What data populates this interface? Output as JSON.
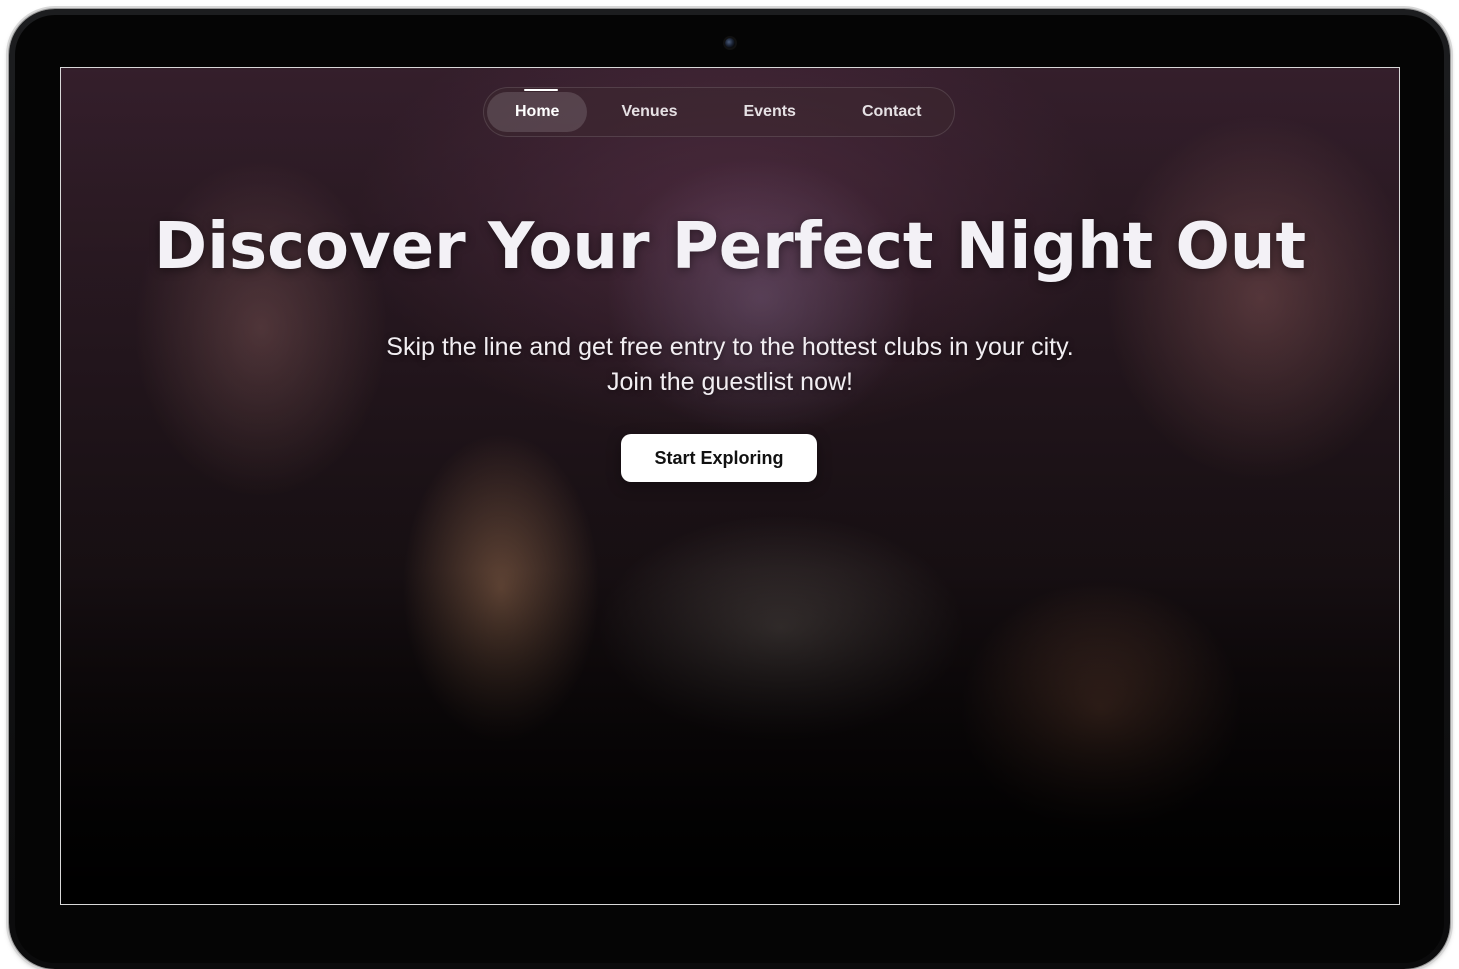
{
  "nav": {
    "items": [
      {
        "label": "Home",
        "active": true
      },
      {
        "label": "Venues",
        "active": false
      },
      {
        "label": "Events",
        "active": false
      },
      {
        "label": "Contact",
        "active": false
      }
    ]
  },
  "hero": {
    "title": "Discover Your Perfect Night Out",
    "subtitle_line1": "Skip the line and get free entry to the hottest clubs in your city.",
    "subtitle_line2": "Join the guestlist now!",
    "cta_label": "Start Exploring"
  },
  "colors": {
    "device_frame": "#111214",
    "cta_background": "#ffffff",
    "cta_text": "#111111",
    "headline_text": "#f3f1f6"
  },
  "icons": {
    "camera": "webcam-icon"
  }
}
